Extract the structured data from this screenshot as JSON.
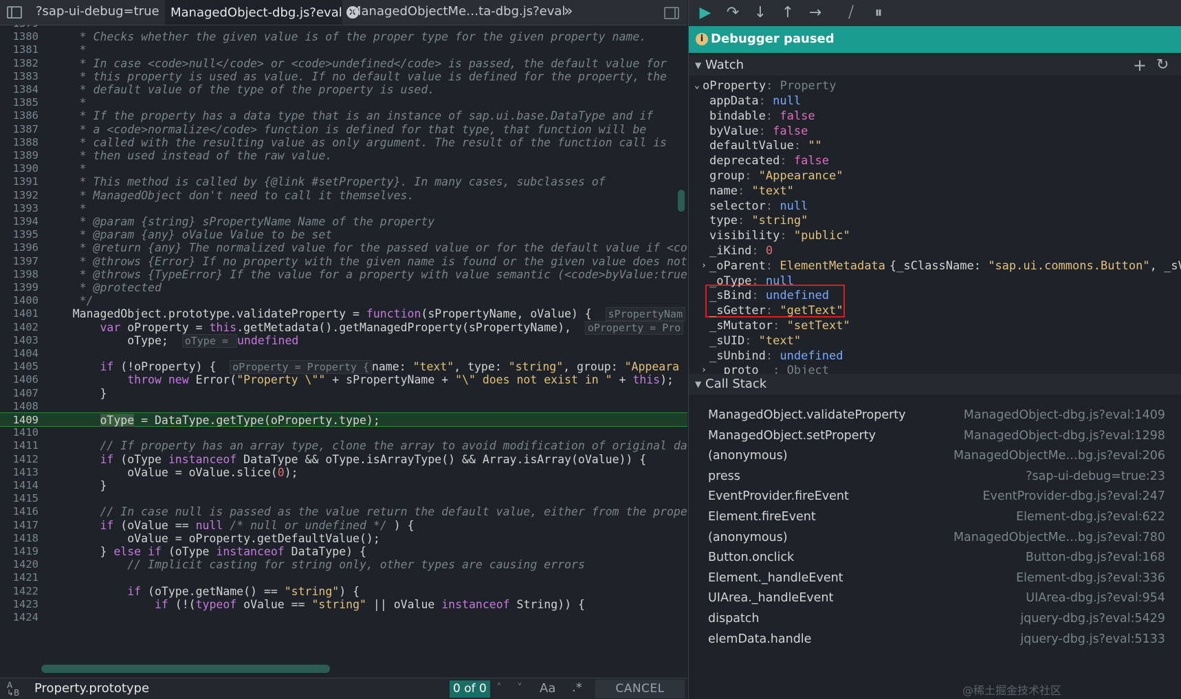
{
  "tabs": {
    "items": [
      {
        "label": "?sap-ui-debug=true"
      },
      {
        "label": "ManagedObject-dbg.js?eval"
      },
      {
        "label": "ManagedObjectMe…ta-dbg.js?eval"
      }
    ],
    "close_glyph": "×",
    "overflow_glyph": "»"
  },
  "code": {
    "lines": [
      {
        "n": "1379",
        "t": ""
      },
      {
        "n": "1380",
        "t": ""
      },
      {
        "n": "1381",
        "t": ""
      },
      {
        "n": "1382",
        "t": ""
      },
      {
        "n": "1383",
        "t": ""
      },
      {
        "n": "1384",
        "t": ""
      },
      {
        "n": "1385",
        "t": ""
      },
      {
        "n": "1386",
        "t": ""
      },
      {
        "n": "1387",
        "t": ""
      },
      {
        "n": "1388",
        "t": ""
      },
      {
        "n": "1389",
        "t": ""
      },
      {
        "n": "1390",
        "t": ""
      },
      {
        "n": "1391",
        "t": ""
      },
      {
        "n": "1392",
        "t": ""
      },
      {
        "n": "1393",
        "t": ""
      },
      {
        "n": "1394",
        "t": ""
      },
      {
        "n": "1395",
        "t": ""
      },
      {
        "n": "1396",
        "t": ""
      },
      {
        "n": "1397",
        "t": ""
      },
      {
        "n": "1398",
        "t": ""
      },
      {
        "n": "1399",
        "t": ""
      },
      {
        "n": "1400",
        "t": ""
      },
      {
        "n": "1401",
        "t": ""
      },
      {
        "n": "1402",
        "t": ""
      },
      {
        "n": "1403",
        "t": ""
      },
      {
        "n": "1404",
        "t": ""
      },
      {
        "n": "1405",
        "t": ""
      },
      {
        "n": "1406",
        "t": ""
      },
      {
        "n": "1407",
        "t": ""
      },
      {
        "n": "1408",
        "t": ""
      },
      {
        "n": "1409",
        "t": ""
      },
      {
        "n": "1410",
        "t": ""
      },
      {
        "n": "1411",
        "t": ""
      },
      {
        "n": "1412",
        "t": ""
      },
      {
        "n": "1413",
        "t": ""
      },
      {
        "n": "1414",
        "t": ""
      },
      {
        "n": "1415",
        "t": ""
      },
      {
        "n": "1416",
        "t": ""
      },
      {
        "n": "1417",
        "t": ""
      },
      {
        "n": "1418",
        "t": ""
      },
      {
        "n": "1419",
        "t": ""
      },
      {
        "n": "1420",
        "t": ""
      },
      {
        "n": "1421",
        "t": ""
      },
      {
        "n": "1422",
        "t": ""
      },
      {
        "n": "1423",
        "t": ""
      },
      {
        "n": "1424",
        "t": ""
      }
    ],
    "text": {
      "l1380": "* Checks whether the given value is of the proper type for the given property name.",
      "l1381": "*",
      "l1382": "* In case <code>null</code> or <code>undefined</code> is passed, the default value for",
      "l1383": "* this property is used as value. If no default value is defined for the property, the",
      "l1384": "* default value of the type of the property is used.",
      "l1385": "*",
      "l1386": "* If the property has a data type that is an instance of sap.ui.base.DataType and if",
      "l1387": "* a <code>normalize</code> function is defined for that type, that function will be",
      "l1388": "* called with the resulting value as only argument. The result of the function call is",
      "l1389": "* then used instead of the raw value.",
      "l1390": "*",
      "l1391": "* This method is called by {@link #setProperty}. In many cases, subclasses of",
      "l1392": "* ManagedObject don't need to call it themselves.",
      "l1393": "*",
      "l1394": "* @param {string} sPropertyName Name of the property",
      "l1395": "* @param {any} oValue Value to be set",
      "l1396": "* @return {any} The normalized value for the passed value or for the default value if <co",
      "l1397": "* @throws {Error} If no property with the given name is found or the given value does not",
      "l1398": "* @throws {TypeError} If the value for a property with value semantic (<code>byValue:true",
      "l1399": "* @protected",
      "l1400": "*/",
      "l1401a": "ManagedObject.prototype.validateProperty = ",
      "l1401b": "function",
      "l1401c": "(sPropertyName, oValue) {  ",
      "l1401d": "sPropertyNam",
      "l1402a": "    ",
      "l1402b": "var",
      "l1402c": " oProperty = ",
      "l1402d": "this",
      "l1402e": ".getMetadata().getManagedProperty(sPropertyName),  ",
      "l1402f": "oProperty = Pro",
      "l1403a": "        oType;  ",
      "l1403b": "oType = ",
      "l1403c": "undefined",
      "l1405a": "    ",
      "l1405b": "if",
      "l1405c": " (!oProperty) {  ",
      "l1405d": "oProperty = Property {",
      "l1405e": "name",
      "l1405f": ": ",
      "l1405g": "\"text\"",
      "l1405h": ", ",
      "l1405i": "type",
      "l1405j": ": ",
      "l1405k": "\"string\"",
      "l1405l": ", ",
      "l1405m": "group",
      "l1405n": ": ",
      "l1405o": "\"Appeara",
      "l1406a": "        ",
      "l1406b": "throw new",
      "l1406c": " Error(",
      "l1406d": "\"Property \\\"\"",
      "l1406e": " + sPropertyName + ",
      "l1406f": "\"\\\" does not exist in \"",
      "l1406g": " + ",
      "l1406h": "this",
      "l1406i": ");",
      "l1407": "    }",
      "l1409a": "    ",
      "l1409b": "oType",
      "l1409c": " = DataType.getType(oProperty.type);",
      "l1411": "    // If property has an array type, clone the array to avoid modification of original da",
      "l1412a": "    ",
      "l1412b": "if",
      "l1412c": " (oType ",
      "l1412d": "instanceof",
      "l1412e": " DataType && oType.isArrayType() && Array.isArray(oValue)) {",
      "l1413a": "        oValue = oValue.slice(",
      "l1413b": "0",
      "l1413c": ");",
      "l1414": "    }",
      "l1416": "    // In case null is passed as the value return the default value, either from the prope",
      "l1417a": "    ",
      "l1417b": "if",
      "l1417c": " (oValue == ",
      "l1417d": "null",
      "l1417e": " ",
      "l1417f": "/* null or undefined */",
      "l1417g": " ) {",
      "l1418": "        oValue = oProperty.getDefaultValue();",
      "l1419a": "    } ",
      "l1419b": "else if",
      "l1419c": " (oType ",
      "l1419d": "instanceof",
      "l1419e": " DataType) {",
      "l1420": "        // Implicit casting for string only, other types are causing errors",
      "l1422a": "        ",
      "l1422b": "if",
      "l1422c": " (oType.getName() == ",
      "l1422d": "\"string\"",
      "l1422e": ") {",
      "l1423a": "            ",
      "l1423b": "if",
      "l1423c": " (!(",
      "l1423d": "typeof",
      "l1423e": " oValue == ",
      "l1423f": "\"string\"",
      "l1423g": " || oValue ",
      "l1423h": "instanceof",
      "l1423i": " String)) {"
    }
  },
  "search": {
    "type_icon": "A\nB",
    "value": "Property.prototype",
    "match_count": "0 of 0",
    "prev_glyph": "˄",
    "next_glyph": "˅",
    "case_label": "Aa",
    "regex_label": ".*",
    "cancel_label": "CANCEL"
  },
  "debugger": {
    "toolbar": {
      "resume": "▶",
      "step_over": "↷",
      "step_into": "↓",
      "step_out": "↑",
      "step": "→",
      "deactivate": "⧸",
      "pause_exceptions": "⏸"
    },
    "status": "Debugger paused",
    "status_icon": "i"
  },
  "watch": {
    "title": "Watch",
    "add_glyph": "+",
    "refresh_glyph": "↻",
    "root": {
      "key": "oProperty",
      "value": "Property"
    },
    "rows": [
      {
        "key": "appData",
        "value": "null",
        "kind": "null"
      },
      {
        "key": "bindable",
        "value": "false",
        "kind": "bool"
      },
      {
        "key": "byValue",
        "value": "false",
        "kind": "bool"
      },
      {
        "key": "defaultValue",
        "value": "\"\"",
        "kind": "str"
      },
      {
        "key": "deprecated",
        "value": "false",
        "kind": "bool"
      },
      {
        "key": "group",
        "value": "\"Appearance\"",
        "kind": "str"
      },
      {
        "key": "name",
        "value": "\"text\"",
        "kind": "str"
      },
      {
        "key": "selector",
        "value": "null",
        "kind": "null"
      },
      {
        "key": "type",
        "value": "\"string\"",
        "kind": "str"
      },
      {
        "key": "visibility",
        "value": "\"public\"",
        "kind": "str"
      },
      {
        "key": "_iKind",
        "value": "0",
        "kind": "num"
      },
      {
        "key": "_oParent",
        "value": "ElementMetadata",
        "kind": "class",
        "extra": "{_sClassName: ",
        "extra_str": "\"sap.ui.commons.Button\"",
        "extra_tail": ", _sV…",
        "expandable": true
      },
      {
        "key": "_oType",
        "value": "null",
        "kind": "null"
      },
      {
        "key": "_sBind",
        "value": "undefined",
        "kind": "null"
      },
      {
        "key": "_sGetter",
        "value": "\"getText\"",
        "kind": "str"
      },
      {
        "key": "_sMutator",
        "value": "\"setText\"",
        "kind": "str"
      },
      {
        "key": "_sUID",
        "value": "\"text\"",
        "kind": "str"
      },
      {
        "key": "_sUnbind",
        "value": "undefined",
        "kind": "null"
      },
      {
        "key": "__proto__",
        "value": "Object",
        "kind": "obj",
        "expandable": true
      }
    ]
  },
  "callstack": {
    "title": "Call Stack",
    "frames": [
      {
        "fn": "ManagedObject.validateProperty",
        "loc": "ManagedObject-dbg.js?eval:1409"
      },
      {
        "fn": "ManagedObject.setProperty",
        "loc": "ManagedObject-dbg.js?eval:1298"
      },
      {
        "fn": "(anonymous)",
        "loc": "ManagedObjectMe…bg.js?eval:206"
      },
      {
        "fn": "press",
        "loc": "?sap-ui-debug=true:23"
      },
      {
        "fn": "EventProvider.fireEvent",
        "loc": "EventProvider-dbg.js?eval:247"
      },
      {
        "fn": "Element.fireEvent",
        "loc": "Element-dbg.js?eval:622"
      },
      {
        "fn": "(anonymous)",
        "loc": "ManagedObjectMe…bg.js?eval:780"
      },
      {
        "fn": "Button.onclick",
        "loc": "Button-dbg.js?eval:168"
      },
      {
        "fn": "Element._handleEvent",
        "loc": "Element-dbg.js?eval:336"
      },
      {
        "fn": "UIArea._handleEvent",
        "loc": "UIArea-dbg.js?eval:954"
      },
      {
        "fn": "dispatch",
        "loc": "jquery-dbg.js?eval:5429"
      },
      {
        "fn": "elemData.handle",
        "loc": "jquery-dbg.js?eval:5133"
      }
    ]
  },
  "watermark": "@稀土掘金技术社区"
}
